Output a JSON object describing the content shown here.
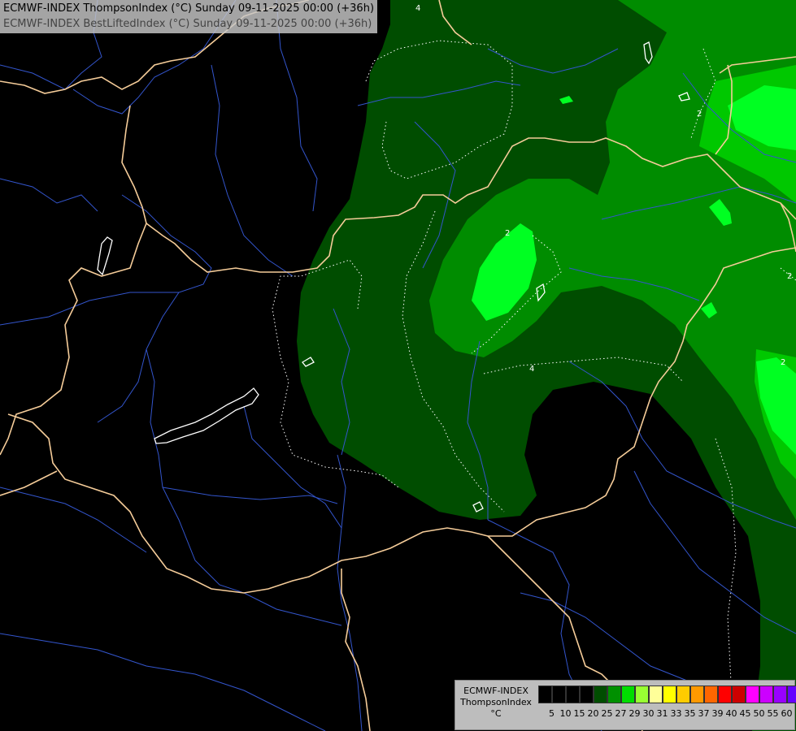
{
  "title": {
    "line1": "ECMWF-INDEX ThompsonIndex (°C) Sunday 09-11-2025 00:00 (+36h)",
    "line2": "ECMWF-INDEX BestLiftedIndex (°C) Sunday 09-11-2025 00:00 (+36h)"
  },
  "contour_labels": [
    "4",
    "2",
    "2",
    "4",
    "2",
    "2"
  ],
  "legend": {
    "model": "ECMWF-INDEX",
    "parameter": "ThompsonIndex",
    "unit": "°C",
    "ticks": [
      "5",
      "10",
      "15",
      "20",
      "25",
      "27",
      "29",
      "30",
      "31",
      "33",
      "35",
      "37",
      "39",
      "40",
      "45",
      "50",
      "55",
      "60"
    ],
    "colors": [
      "#000000",
      "#000000",
      "#000000",
      "#000000",
      "#004d00",
      "#009000",
      "#00dd00",
      "#99ff33",
      "#ffff99",
      "#ffff00",
      "#ffcc00",
      "#ff9900",
      "#ff6600",
      "#ff0000",
      "#cc0000",
      "#ff00ff",
      "#cc00ff",
      "#9900ff",
      "#6600ff",
      "#0000ff"
    ]
  },
  "fill_colors": {
    "level1": "#004d00",
    "level2": "#008c00",
    "level3": "#00c800",
    "level4": "#00ff22"
  },
  "line_colors": {
    "border": "#f5cc99",
    "river": "#3355cc",
    "lake": "#ffffff"
  }
}
